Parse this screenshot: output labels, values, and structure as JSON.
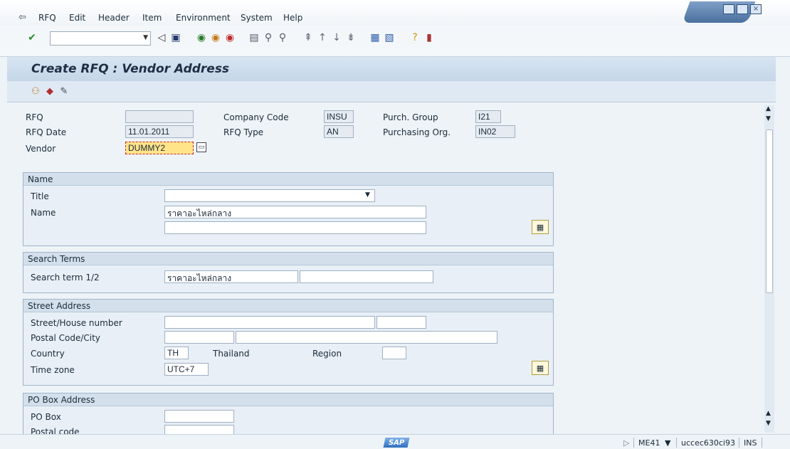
{
  "menu": {
    "items": [
      {
        "label": "RFQ"
      },
      {
        "label": "Edit"
      },
      {
        "label": "Header"
      },
      {
        "label": "Item"
      },
      {
        "label": "Environment"
      },
      {
        "label": "System"
      },
      {
        "label": "Help"
      }
    ]
  },
  "toolbar": {
    "icons": [
      "enter-icon",
      "save-icon",
      "back-icon",
      "exit-icon",
      "cancel-icon",
      "print-icon",
      "find-icon",
      "find-next-icon",
      "first-page-icon",
      "previous-page-icon",
      "next-page-icon",
      "last-page-icon",
      "create-session-icon",
      "shortcut-icon",
      "help-icon",
      "layout-menu-icon"
    ]
  },
  "title": "Create RFQ : Vendor Address",
  "header": {
    "rfq_label": "RFQ",
    "rfq_value": "",
    "rfq_date_label": "RFQ Date",
    "rfq_date_value": "11.01.2011",
    "vendor_label": "Vendor",
    "vendor_value": "DUMMY2",
    "company_code_label": "Company Code",
    "company_code_value": "INSU",
    "rfq_type_label": "RFQ Type",
    "rfq_type_value": "AN",
    "purch_group_label": "Purch. Group",
    "purch_group_value": "I21",
    "purch_org_label": "Purchasing Org.",
    "purch_org_value": "IN02"
  },
  "name_group": {
    "title": "Name",
    "title_label": "Title",
    "title_value": "",
    "name_label": "Name",
    "name_value": "ราคาอะไหล่กลาง",
    "name2_value": ""
  },
  "search_group": {
    "title": "Search Terms",
    "term_label": "Search term 1/2",
    "term1_value": "ราคาอะไหล่กลาง",
    "term2_value": ""
  },
  "street_group": {
    "title": "Street Address",
    "street_label": "Street/House number",
    "postal_label": "Postal Code/City",
    "country_label": "Country",
    "country_value": "TH",
    "country_name": "Thailand",
    "region_label": "Region",
    "region_value": "",
    "timezone_label": "Time zone",
    "timezone_value": "UTC+7"
  },
  "pobox_group": {
    "title": "PO Box Address",
    "pobox_label": "PO Box",
    "postal_label": "Postal code"
  },
  "status": {
    "transaction": "ME41",
    "server": "uccec630ci93",
    "mode": "INS"
  }
}
